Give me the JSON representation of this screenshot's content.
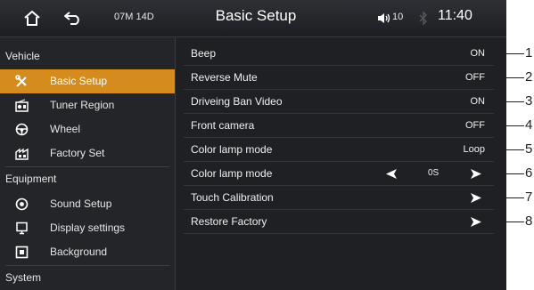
{
  "header": {
    "date": "07M 14D",
    "title": "Basic Setup",
    "volume": "10",
    "time": "11:40",
    "icons": [
      "home-icon",
      "back-icon",
      "volume-icon",
      "bluetooth-icon"
    ]
  },
  "sidebar": {
    "sections": [
      {
        "label": "Vehicle"
      },
      {
        "label": "Equipment"
      },
      {
        "label": "System"
      }
    ],
    "items": [
      {
        "label": "Basic Setup",
        "icon": "tools-icon",
        "active": true
      },
      {
        "label": "Tuner Region",
        "icon": "radio-icon"
      },
      {
        "label": "Wheel",
        "icon": "steering-wheel-icon"
      },
      {
        "label": "Factory Set",
        "icon": "factory-icon"
      },
      {
        "label": "Sound Setup",
        "icon": "sound-icon"
      },
      {
        "label": "Display settings",
        "icon": "display-icon"
      },
      {
        "label": "Background",
        "icon": "background-icon"
      }
    ]
  },
  "settings": [
    {
      "label": "Beep",
      "value": "ON"
    },
    {
      "label": "Reverse Mute",
      "value": "OFF"
    },
    {
      "label": "Driveing Ban Video",
      "value": "ON"
    },
    {
      "label": "Front camera",
      "value": "OFF"
    },
    {
      "label": "Color lamp mode",
      "value": "Loop"
    },
    {
      "label": "Color lamp mode",
      "value": "0S"
    },
    {
      "label": "Touch Calibration"
    },
    {
      "label": "Restore Factory"
    }
  ],
  "callouts": [
    "1",
    "2",
    "3",
    "4",
    "5",
    "6",
    "7",
    "8"
  ],
  "colors": {
    "accent": "#d68b1d",
    "background": "#1e2024",
    "text": "#f0f0f0"
  }
}
